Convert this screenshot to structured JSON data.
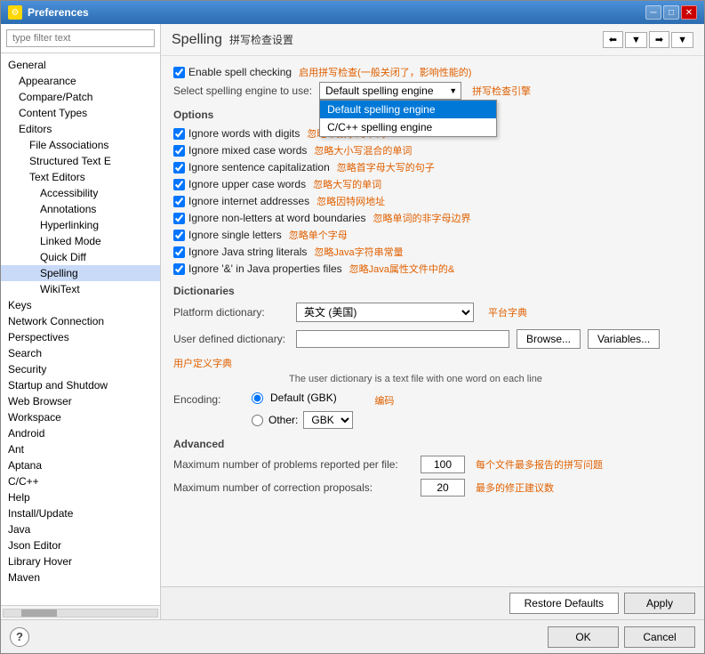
{
  "window": {
    "title": "Preferences",
    "icon": "⚙"
  },
  "sidebar": {
    "search_placeholder": "type filter text",
    "items": [
      {
        "id": "general",
        "label": "General",
        "level": 0
      },
      {
        "id": "appearance",
        "label": "Appearance",
        "level": 1
      },
      {
        "id": "compare-patch",
        "label": "Compare/Patch",
        "level": 1
      },
      {
        "id": "content-types",
        "label": "Content Types",
        "level": 1
      },
      {
        "id": "editors",
        "label": "Editors",
        "level": 1
      },
      {
        "id": "file-associations",
        "label": "File Associations",
        "level": 2
      },
      {
        "id": "structured-text",
        "label": "Structured Text E",
        "level": 2
      },
      {
        "id": "text-editors",
        "label": "Text Editors",
        "level": 2
      },
      {
        "id": "accessibility",
        "label": "Accessibility",
        "level": 3
      },
      {
        "id": "annotations",
        "label": "Annotations",
        "level": 3
      },
      {
        "id": "hyperlinking",
        "label": "Hyperlinking",
        "level": 3
      },
      {
        "id": "linked-mode",
        "label": "Linked Mode",
        "level": 3
      },
      {
        "id": "quick-diff",
        "label": "Quick Diff",
        "level": 3
      },
      {
        "id": "spelling",
        "label": "Spelling",
        "level": 3,
        "selected": true
      },
      {
        "id": "wikitext",
        "label": "WikiText",
        "level": 3
      },
      {
        "id": "keys",
        "label": "Keys",
        "level": 0
      },
      {
        "id": "network-connection",
        "label": "Network Connection",
        "level": 0
      },
      {
        "id": "perspectives",
        "label": "Perspectives",
        "level": 0
      },
      {
        "id": "search",
        "label": "Search",
        "level": 0
      },
      {
        "id": "security",
        "label": "Security",
        "level": 0
      },
      {
        "id": "startup-shutdown",
        "label": "Startup and Shutdow",
        "level": 0
      },
      {
        "id": "web-browser",
        "label": "Web Browser",
        "level": 0
      },
      {
        "id": "workspace",
        "label": "Workspace",
        "level": 0
      },
      {
        "id": "android",
        "label": "Android",
        "level": 0
      },
      {
        "id": "ant",
        "label": "Ant",
        "level": 0
      },
      {
        "id": "aptana",
        "label": "Aptana",
        "level": 0
      },
      {
        "id": "cplusplus",
        "label": "C/C++",
        "level": 0
      },
      {
        "id": "help",
        "label": "Help",
        "level": 0
      },
      {
        "id": "install-update",
        "label": "Install/Update",
        "level": 0
      },
      {
        "id": "java",
        "label": "Java",
        "level": 0
      },
      {
        "id": "json-editor",
        "label": "Json Editor",
        "level": 0
      },
      {
        "id": "library-hover",
        "label": "Library Hover",
        "level": 0
      },
      {
        "id": "maven",
        "label": "Maven",
        "level": 0
      }
    ]
  },
  "content": {
    "title": "Spelling",
    "title_cn": "拼写检查设置",
    "enable_spell_label": "Enable spell checking",
    "enable_spell_cn": "启用拼写检查(一般关闭了，影响性能的)",
    "engine_label": "Select spelling engine to use:",
    "engine_selected": "Default spelling engine",
    "engine_cn": "拼写检查引擎",
    "engine_options": [
      {
        "label": "Default spelling engine",
        "selected": true
      },
      {
        "label": "C/C++ spelling engine",
        "selected": false
      }
    ],
    "options_label": "Options",
    "checkboxes": [
      {
        "id": "ignore-digits",
        "en": "Ignore words with digits",
        "cn": "忽略带数字的单词",
        "checked": true
      },
      {
        "id": "ignore-mixed",
        "en": "Ignore mixed case words",
        "cn": "忽略大小写混合的单词",
        "checked": true
      },
      {
        "id": "ignore-sentence",
        "en": "Ignore sentence capitalization",
        "cn": "忽略首字母大写的句子",
        "checked": true
      },
      {
        "id": "ignore-upper",
        "en": "Ignore upper case words",
        "cn": "忽略大写的单词",
        "checked": true
      },
      {
        "id": "ignore-internet",
        "en": "Ignore internet addresses",
        "cn": "忽略因特网地址",
        "checked": true
      },
      {
        "id": "ignore-nonletters",
        "en": "Ignore non-letters at word boundaries",
        "cn": "忽略单词的非字母边界",
        "checked": true
      },
      {
        "id": "ignore-single",
        "en": "Ignore single letters",
        "cn": "忽略单个字母",
        "checked": true
      },
      {
        "id": "ignore-java",
        "en": "Ignore Java string literals",
        "cn": "忽略Java字符串常量",
        "checked": true
      },
      {
        "id": "ignore-ampersand",
        "en": "Ignore '&' in Java properties files",
        "cn": "忽略Java属性文件中的&",
        "checked": true
      }
    ],
    "dictionaries_label": "Dictionaries",
    "platform_dict_label": "Platform dictionary:",
    "platform_dict_value": "英文 (美国)",
    "platform_dict_cn": "平台字典",
    "user_dict_label": "User defined dictionary:",
    "user_dict_cn": "用户定义字典",
    "browse_btn": "Browse...",
    "variables_btn": "Variables...",
    "dict_hint": "The user dictionary is a text file with one word on each line",
    "encoding_label": "Encoding:",
    "encoding_cn": "编码",
    "encoding_default": "Default (GBK)",
    "encoding_other": "Other:",
    "encoding_other_value": "GBK",
    "advanced_label": "Advanced",
    "max_problems_label": "Maximum number of problems reported per file:",
    "max_problems_cn": "每个文件最多报告的拼写问题",
    "max_problems_value": "100",
    "max_corrections_label": "Maximum number of correction proposals:",
    "max_corrections_cn": "最多的修正建议数",
    "max_corrections_value": "20"
  },
  "footer": {
    "restore_defaults": "Restore Defaults",
    "apply": "Apply",
    "ok": "OK",
    "cancel": "Cancel",
    "help_icon": "?"
  }
}
